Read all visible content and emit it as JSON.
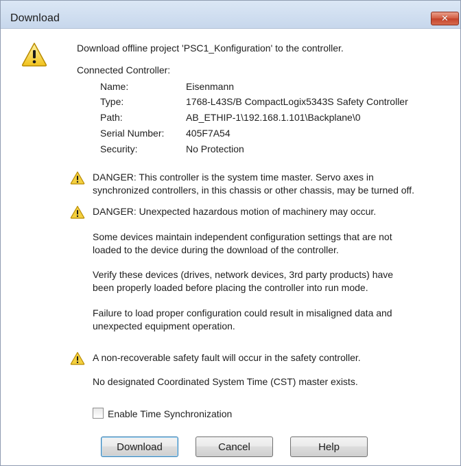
{
  "window": {
    "title": "Download",
    "close_label": "✕"
  },
  "icons": {
    "main": "warning-icon",
    "danger1": "warning-icon",
    "danger2": "warning-icon",
    "safety": "warning-icon",
    "warning_fill": "#f4d03f",
    "warning_stroke": "#b88a00",
    "close_red": "#d25a3f"
  },
  "message": {
    "intro": "Download offline project 'PSC1_Konfiguration' to the controller.",
    "connected_controller": "Connected Controller:",
    "fields": [
      {
        "label": "Name:",
        "value": "Eisenmann"
      },
      {
        "label": "Type:",
        "value": "1768-L43S/B CompactLogix5343S Safety Controller"
      },
      {
        "label": "Path:",
        "value": "AB_ETHIP-1\\192.168.1.101\\Backplane\\0"
      },
      {
        "label": "Serial Number:",
        "value": "405F7A54"
      },
      {
        "label": "Security:",
        "value": "No Protection"
      }
    ]
  },
  "warnings": {
    "danger1_line1": "DANGER: This controller is the system time master.  Servo axes in",
    "danger1_line2": "synchronized controllers, in this chassis or other chassis, may be turned off.",
    "danger2": "DANGER: Unexpected hazardous motion of machinery may occur.",
    "p1_line1": "Some devices maintain independent configuration settings that are not",
    "p1_line2": "loaded to the device during the download of the controller.",
    "p2_line1": "Verify these devices (drives, network devices, 3rd party products) have",
    "p2_line2": "been properly loaded before placing the controller into run mode.",
    "p3_line1": "Failure to load proper configuration could result in misaligned data and",
    "p3_line2": "unexpected equipment operation.",
    "safety": "A non-recoverable safety fault will occur in the safety controller.",
    "cst": "No designated Coordinated System Time (CST) master exists."
  },
  "options": {
    "time_sync_label": "Enable Time Synchronization",
    "time_sync_checked": false
  },
  "buttons": {
    "download": "Download",
    "cancel": "Cancel",
    "help": "Help"
  }
}
